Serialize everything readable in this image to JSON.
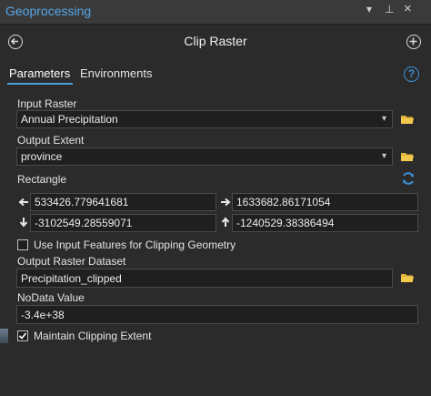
{
  "window": {
    "title": "Geoprocessing",
    "controls": {
      "menu": "▾",
      "pin": "⊥",
      "close": "×"
    }
  },
  "header": {
    "title": "Clip Raster",
    "back_icon": "back-icon",
    "add_icon": "add-icon"
  },
  "tabs": [
    {
      "label": "Parameters",
      "active": true
    },
    {
      "label": "Environments",
      "active": false
    }
  ],
  "help": {
    "glyph": "?"
  },
  "form": {
    "input_raster": {
      "label": "Input Raster",
      "value": "Annual Precipitation"
    },
    "output_extent": {
      "label": "Output Extent",
      "value": "province"
    },
    "rectangle": {
      "label": "Rectangle",
      "left": "533426.779641681",
      "right": "1633682.86171054",
      "bottom": "-3102549.28559071",
      "top": "-1240529.38386494"
    },
    "use_input_features": {
      "label": "Use Input Features for Clipping Geometry",
      "checked": false
    },
    "output_raster_dataset": {
      "label": "Output Raster Dataset",
      "value": "Precipitation_clipped"
    },
    "nodata": {
      "label": "NoData Value",
      "value": "-3.4e+38"
    },
    "maintain_extent": {
      "label": "Maintain Clipping Extent",
      "checked": true
    }
  },
  "colors": {
    "accent": "#4c9ed9",
    "title": "#55a7e8",
    "folder": "#e1b43a",
    "background": "#2b2b2b"
  }
}
